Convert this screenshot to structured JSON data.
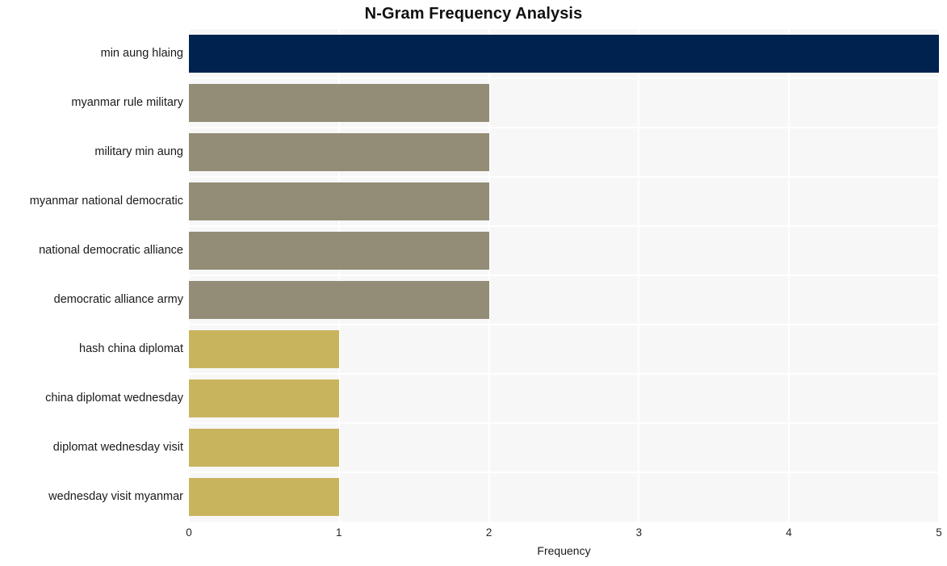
{
  "chart_data": {
    "type": "bar",
    "orientation": "horizontal",
    "title": "N-Gram Frequency Analysis",
    "xlabel": "Frequency",
    "ylabel": "",
    "xlim": [
      0,
      5
    ],
    "xticks": [
      "0",
      "1",
      "2",
      "3",
      "4",
      "5"
    ],
    "grid": true,
    "legend": "none",
    "categories": [
      "min aung hlaing",
      "myanmar rule military",
      "military min aung",
      "myanmar national democratic",
      "national democratic alliance",
      "democratic alliance army",
      "hash china diplomat",
      "china diplomat wednesday",
      "diplomat wednesday visit",
      "wednesday visit myanmar"
    ],
    "values": [
      5,
      2,
      2,
      2,
      2,
      2,
      1,
      1,
      1,
      1
    ],
    "bar_colors": [
      "#00224e",
      "#938c76",
      "#938c76",
      "#938c76",
      "#938c76",
      "#938c76",
      "#c9b45e",
      "#c9b45e",
      "#c9b45e",
      "#c9b45e"
    ],
    "plot_background": "#f7f7f7",
    "grid_color": "#ffffff",
    "page_background": "#ffffff"
  }
}
